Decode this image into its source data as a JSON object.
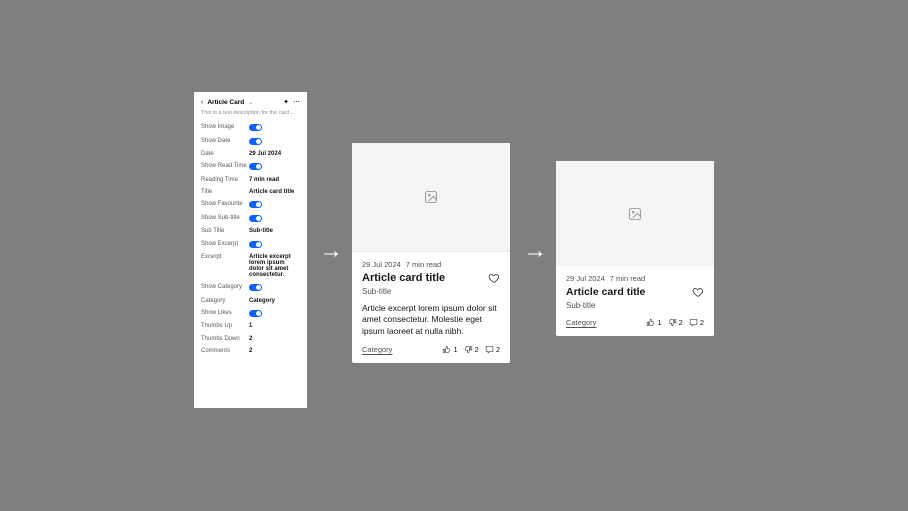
{
  "panel": {
    "title": "Article Card",
    "description": "This is a test description for the card ...",
    "props": {
      "show_image": "Show Image",
      "show_date": "Show Date",
      "date_key": "Date",
      "date_val": "29 Jul 2024",
      "show_read_time": "Show Read Time",
      "reading_time_key": "Reading Time",
      "reading_time_val": "7 min read",
      "title_key": "Title",
      "title_val": "Article card title",
      "show_favourite": "Show Favourite",
      "show_subtitle": "Show Sub-title",
      "subtitle_key": "Sub Title",
      "subtitle_val": "Sub-title",
      "show_excerpt": "Show Excerpt",
      "excerpt_key": "Excerpt",
      "excerpt_val": "Article excerpt lorem ipsum dolor sit amet consectetur.",
      "show_category": "Show Category",
      "category_key": "Category",
      "category_val": "Category",
      "show_likes": "Show Likes",
      "thumbs_up_key": "Thumbs Up",
      "thumbs_up_val": "1",
      "thumbs_down_key": "Thumbs Down",
      "thumbs_down_val": "2",
      "comments_key": "Comments",
      "comments_val": "2"
    }
  },
  "card": {
    "date": "29 Jul 2024",
    "read_time": "7 min read",
    "title": "Article card title",
    "subtitle": "Sub-title",
    "excerpt": "Article excerpt lorem ipsum dolor sit amet consectetur. Molestie eget ipsum laoreet at nulla nibh.",
    "category": "Category",
    "thumbs_up": "1",
    "thumbs_down": "2",
    "comments": "2"
  }
}
